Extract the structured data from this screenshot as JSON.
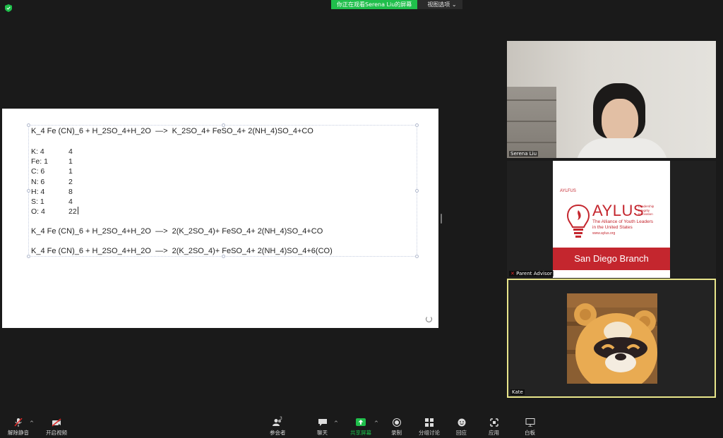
{
  "banner": {
    "viewing": "你正在观看Serena Liu的屏幕",
    "view_options": "视图选项"
  },
  "shared_doc": {
    "equation1": "K_4 Fe (CN)_6 + H_2SO_4+H_2O  —>  K_2SO_4+ FeSO_4+ 2(NH_4)SO_4+CO",
    "counts": [
      {
        "element": "K: 4",
        "right": "4"
      },
      {
        "element": "Fe: 1",
        "right": "1"
      },
      {
        "element": "C: 6",
        "right": "1"
      },
      {
        "element": "N: 6",
        "right": "2"
      },
      {
        "element": "H: 4",
        "right": "8"
      },
      {
        "element": "S: 1",
        "right": "4"
      },
      {
        "element": "O: 4",
        "right": "22"
      }
    ],
    "equation2": "K_4 Fe (CN)_6 + H_2SO_4+H_2O  —>  2(K_2SO_4)+ FeSO_4+ 2(NH_4)SO_4+CO",
    "equation3": "K_4 Fe (CN)_6 + H_2SO_4+H_2O  —>  2(K_2SO_4)+ FeSO_4+ 2(NH_4)SO_4+6(CO)"
  },
  "participants": [
    {
      "name": "Serena Liu"
    },
    {
      "name": "Parent Advisor"
    },
    {
      "name": "Kate"
    }
  ],
  "aylus": {
    "small": "AYLFUS",
    "big": "AYLUS",
    "tagline": [
      "Leadership",
      "Integrity",
      "Innovation"
    ],
    "desc": [
      "The Alliance of Youth Leaders",
      "in the United States"
    ],
    "url": "www.aylus.org",
    "branch": "San Diego Branch"
  },
  "toolbar": {
    "unmute": "解除静音",
    "start_video": "开启视频",
    "participants": "参会者",
    "participants_count": "3",
    "chat": "聊天",
    "share_screen": "共享屏幕",
    "record": "录制",
    "breakout": "分组讨论",
    "reactions": "回应",
    "apps": "应用",
    "whiteboard": "白板"
  },
  "colors": {
    "share_green": "#1fbf4b",
    "aylus_red": "#c4262e",
    "active_speaker": "#e9e68b",
    "mute_red": "#e02828"
  }
}
